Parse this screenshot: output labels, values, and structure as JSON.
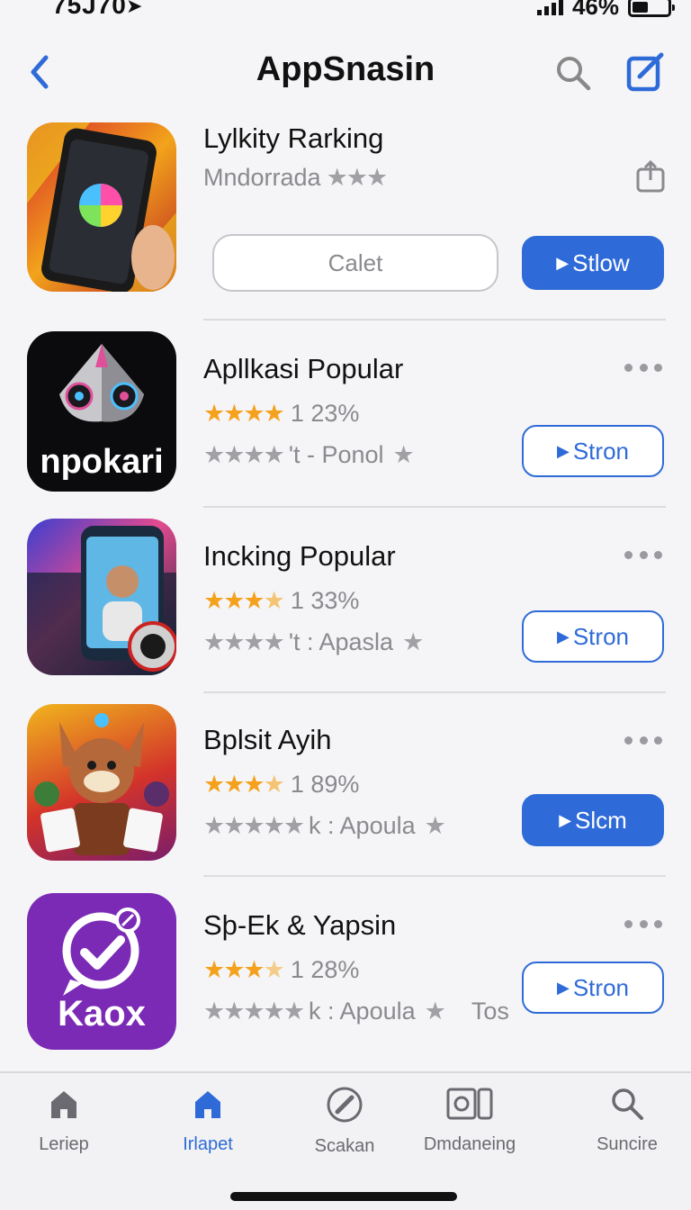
{
  "status_bar": {
    "time": "75J70",
    "battery_percent": "46%",
    "battery_level": 0.46,
    "signal_bars": 4
  },
  "nav": {
    "title": "AppSnasin",
    "back_icon": "chevron-left-icon",
    "search_icon": "search-icon",
    "compose_icon": "compose-icon"
  },
  "colors": {
    "accent": "#2f6bd8",
    "star_gold": "#f4a21d",
    "star_grey": "#a0a0a5"
  },
  "featured": {
    "name": "Lylkity Rarking",
    "subtitle": "Mndorrada",
    "secondary_button": "Calet",
    "primary_button": "Stlow",
    "share_icon": "share-icon"
  },
  "apps": [
    {
      "name": "Apllkasi Popular",
      "rating_percent": "1 23%",
      "meta": "'t  -  Ponol",
      "button": "Stron",
      "button_style": "outline",
      "icon_text": "npokari"
    },
    {
      "name": "Incking Popular",
      "rating_percent": "1 33%",
      "meta": "'t  :  Apasla",
      "button": "Stron",
      "button_style": "outline",
      "icon_text": ""
    },
    {
      "name": "Bplsit Ayih",
      "rating_percent": "1 89%",
      "meta": "k  :  Apoula",
      "button": "Slcm",
      "button_style": "filled",
      "icon_text": ""
    },
    {
      "name": "Sþ-Ek & Yapsin",
      "rating_percent": "1 28%",
      "meta": "k  :  Apoula",
      "meta_suffix": "Tos",
      "button": "Stron",
      "button_style": "outline",
      "icon_text": "Kaox"
    }
  ],
  "tabs": [
    {
      "label": "Leriep",
      "icon": "home-icon",
      "active": false
    },
    {
      "label": "Irlapet",
      "icon": "home-icon",
      "active": true
    },
    {
      "label": "Scakan",
      "icon": "edit-circle-icon",
      "active": false
    },
    {
      "label": "Dmdaneing",
      "icon": "gallery-icon",
      "active": false
    },
    {
      "label": "Suncire",
      "icon": "search-icon",
      "active": false
    }
  ]
}
